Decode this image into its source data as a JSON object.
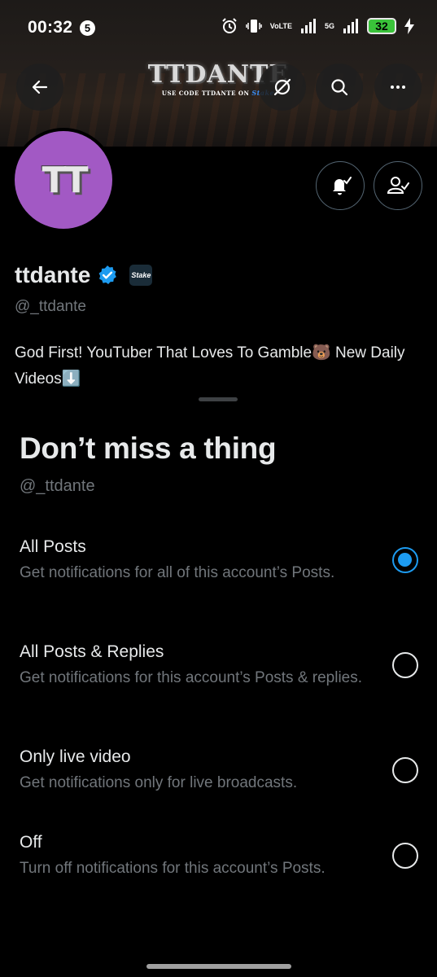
{
  "status_bar": {
    "time": "00:32",
    "notification_count": "5",
    "network_label_top": "Vo",
    "network_label_bottom": "LTE",
    "network_5g": "5G",
    "battery": "32"
  },
  "banner": {
    "title": "TTDANTE",
    "subtitle": "USE CODE TTDANTE ON",
    "subtitle_brand": "Stake"
  },
  "profile": {
    "avatar_text": "TT",
    "display_name": "ttdante",
    "affiliate_badge": "Stake",
    "handle": "@_ttdante",
    "bio": "God First! YouTuber That Loves To Gamble🐻 New Daily Videos⬇️"
  },
  "sheet": {
    "title": "Don’t miss a thing",
    "handle": "@_ttdante",
    "options": [
      {
        "label": "All Posts",
        "description": "Get notifications for all of this account’s Posts.",
        "selected": true
      },
      {
        "label": "All Posts & Replies",
        "description": "Get notifications for this account’s Posts & replies.",
        "selected": false
      },
      {
        "label": "Only live video",
        "description": "Get notifications only for live broadcasts.",
        "selected": false
      },
      {
        "label": "Off",
        "description": "Turn off notifications for this account’s Posts.",
        "selected": false
      }
    ]
  },
  "colors": {
    "accent": "#1d9bf0",
    "avatar_bg": "#a259c4",
    "battery": "#3ac33a",
    "muted_text": "#71767b"
  },
  "icons": [
    "back-arrow-icon",
    "grok-icon",
    "search-icon",
    "more-icon",
    "notification-bell-icon",
    "following-icon",
    "verified-icon",
    "alarm-icon",
    "vibrate-icon",
    "signal-icon",
    "charging-icon"
  ]
}
